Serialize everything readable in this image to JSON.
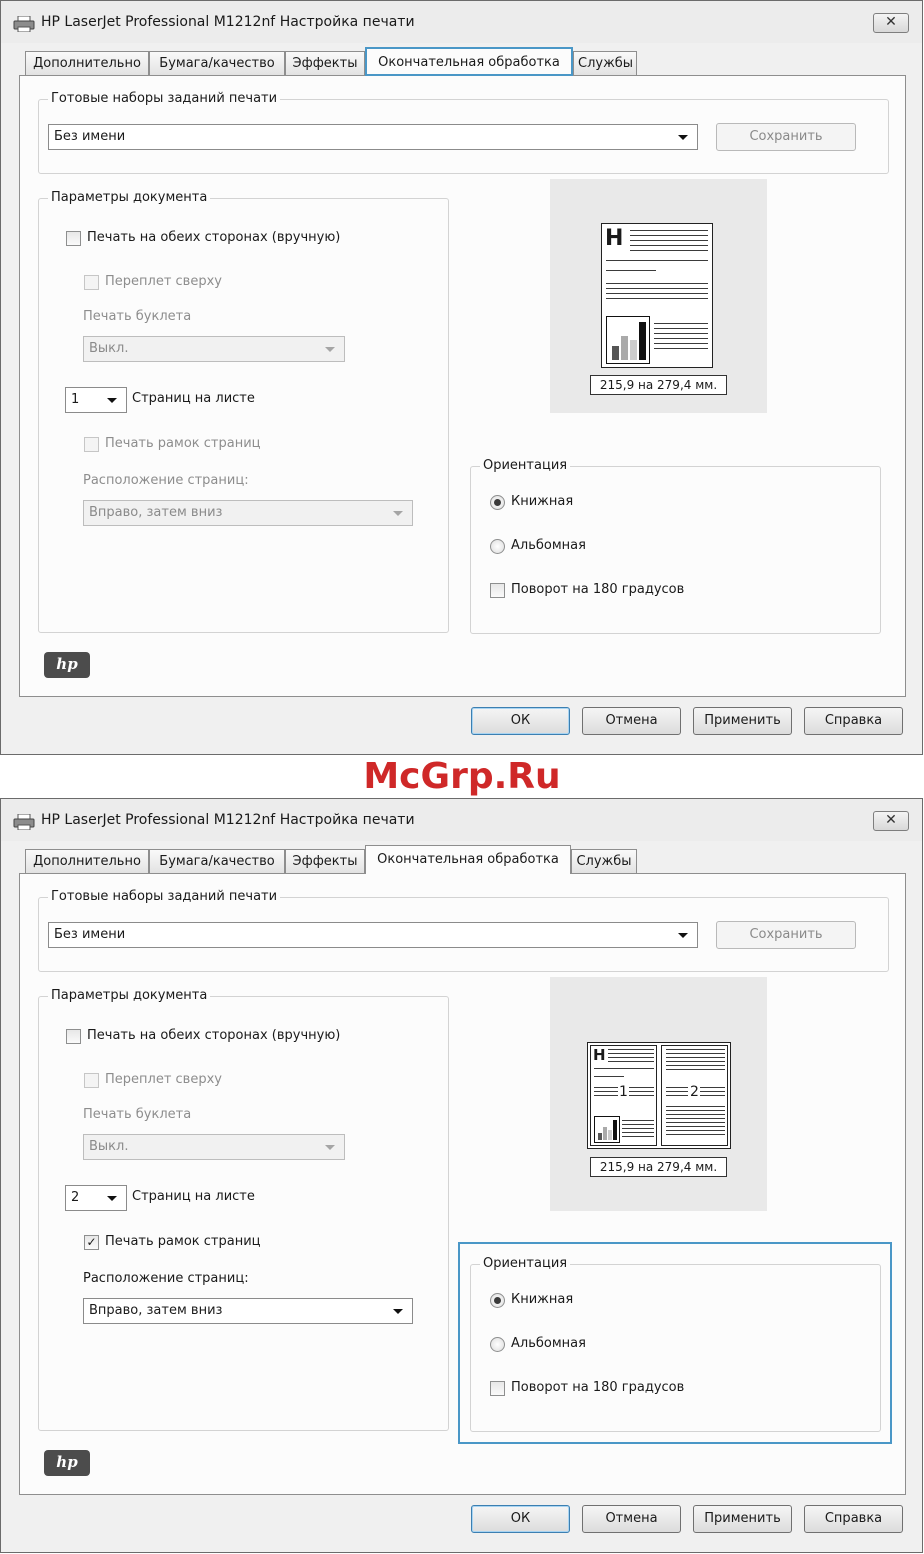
{
  "watermark": "McGrp.Ru",
  "window_title": "HP LaserJet Professional M1212nf Настройка печати",
  "close_glyph": "✕",
  "tabs": [
    {
      "label": "Дополнительно"
    },
    {
      "label": "Бумага/качество"
    },
    {
      "label": "Эффекты"
    },
    {
      "label": "Окончательная обработка"
    },
    {
      "label": "Службы"
    }
  ],
  "active_tab": "Окончательная обработка",
  "presets": {
    "group_label": "Готовые наборы заданий печати",
    "value": "Без имени",
    "save_label": "Сохранить"
  },
  "document": {
    "group_label": "Параметры документа",
    "duplex_label": "Печать на обеих сторонах (вручную)",
    "flip_label": "Переплет сверху",
    "booklet_label": "Печать буклета",
    "booklet_value": "Выкл.",
    "pages_per_sheet_label": "Страниц на листе",
    "borders_label": "Печать рамок страниц",
    "order_label": "Расположение страниц:",
    "order_value": "Вправо, затем вниз"
  },
  "preview": {
    "size_label": "215,9 на 279,4 мм.",
    "page_letter": "H",
    "page_numbers": [
      "1",
      "2"
    ]
  },
  "orientation": {
    "group_label": "Ориентация",
    "portrait_label": "Книжная",
    "landscape_label": "Альбомная",
    "rotate_label": "Поворот на 180 градусов",
    "selected": "Книжная"
  },
  "footer": {
    "ok": "ОК",
    "cancel": "Отмена",
    "apply": "Применить",
    "help": "Справка"
  },
  "logo_text": "hp",
  "states": [
    {
      "pages_per_sheet": "1",
      "borders_checked": false,
      "highlight": "tab-finishing"
    },
    {
      "pages_per_sheet": "2",
      "borders_checked": true,
      "highlight": "orientation-group"
    }
  ],
  "check_glyph": "✓",
  "colors": {
    "highlight": "#4a97c7",
    "watermark": "#cf2828",
    "dialog_bg": "#f0f0f0"
  }
}
